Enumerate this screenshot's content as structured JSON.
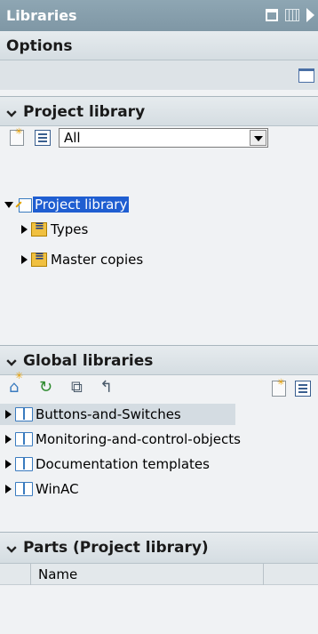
{
  "panel": {
    "title": "Libraries"
  },
  "options": {
    "header": "Options"
  },
  "project_library": {
    "header": "Project library",
    "filter_value": "All",
    "tree": {
      "root": "Project library",
      "children": [
        "Types",
        "Master copies"
      ]
    }
  },
  "global_libraries": {
    "header": "Global libraries",
    "items": [
      "Buttons-and-Switches",
      "Monitoring-and-control-objects",
      "Documentation templates",
      "WinAC"
    ]
  },
  "parts": {
    "header": "Parts (Project library)",
    "columns": [
      "Name"
    ]
  },
  "colors": {
    "title_bar": "#8ea6b3",
    "selection": "#1f5ed1",
    "icon_blue": "#3a7bbf",
    "icon_orange": "#e8a000"
  }
}
